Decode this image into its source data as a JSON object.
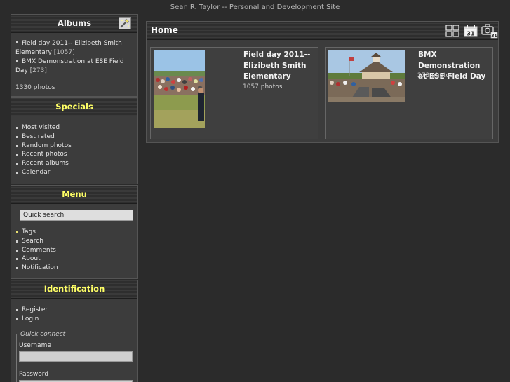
{
  "site": {
    "title": "Sean R. Taylor -- Personal and Development Site"
  },
  "albums_block": {
    "title": "Albums",
    "items": [
      {
        "name": "Field day 2011-- Elizibeth Smith Elementary",
        "count": "[1057]"
      },
      {
        "name": "BMX Demonstration at ESE Field Day",
        "count": "[273]"
      }
    ],
    "total": "1330 photos"
  },
  "specials_block": {
    "title": "Specials",
    "items": [
      "Most visited",
      "Best rated",
      "Random photos",
      "Recent photos",
      "Recent albums",
      "Calendar"
    ]
  },
  "menu_block": {
    "title": "Menu",
    "search_value": "Quick search",
    "items": [
      "Tags",
      "Search",
      "Comments",
      "About",
      "Notification"
    ]
  },
  "identification_block": {
    "title": "Identification",
    "items": [
      "Register",
      "Login"
    ],
    "quick_connect": "Quick connect",
    "username_label": "Username",
    "password_label": "Password"
  },
  "main": {
    "title": "Home",
    "icons": [
      "thumbnails-view-icon",
      "calendar-icon",
      "camera-calendar-icon"
    ],
    "calendar_day": "31",
    "albums": [
      {
        "name_lines": [
          "Field day 2011--",
          "Elizibeth Smith",
          "Elementary"
        ],
        "count": "1057 photos"
      },
      {
        "name_lines": [
          "BMX Demonstration",
          "at ESE Field Day"
        ],
        "count": "273 photos"
      }
    ]
  },
  "colors": {
    "background": "#2b2b2b",
    "panel": "#3c3c3c",
    "accent_yellow": "#ffff66"
  }
}
